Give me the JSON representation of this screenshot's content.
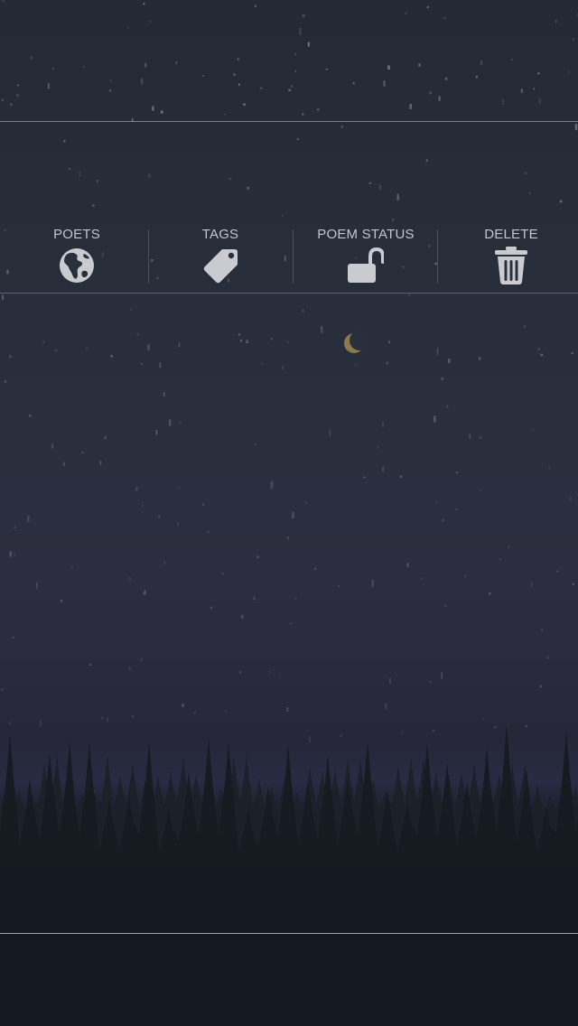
{
  "toolbar": {
    "items": [
      {
        "label": "POETS",
        "icon": "globe-icon"
      },
      {
        "label": "TAGS",
        "icon": "tag-icon"
      },
      {
        "label": "POEM STATUS",
        "icon": "unlocked-padlock-icon"
      },
      {
        "label": "DELETE",
        "icon": "trash-icon"
      }
    ]
  },
  "colors": {
    "label": "#c2c5ca",
    "icon": "#c9cbd0",
    "divider": "#8e939b"
  }
}
